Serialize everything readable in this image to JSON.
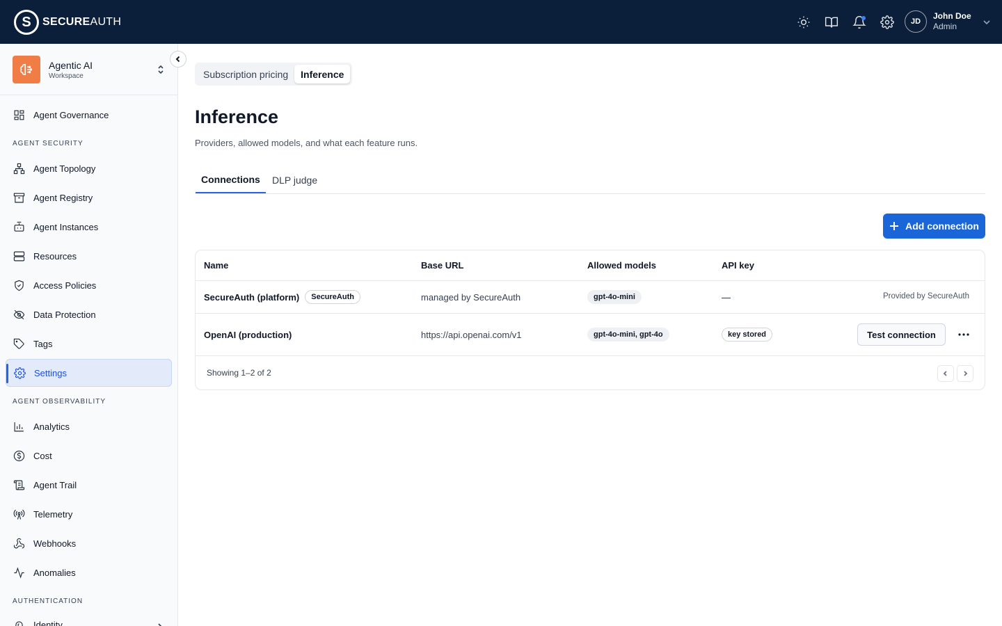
{
  "brand": {
    "logo_glyph": "S",
    "name_bold": "SECURE",
    "name_rest": "AUTH"
  },
  "topbar": {
    "icons": [
      "sun-icon",
      "book-icon",
      "bell-icon",
      "gear-icon"
    ],
    "user": {
      "initials": "JD",
      "name": "John Doe",
      "role": "Admin"
    }
  },
  "workspace": {
    "name": "Agentic AI",
    "subtitle": "Workspace",
    "icon": "agent-icon"
  },
  "sidebar": {
    "top_item": {
      "label": "Agent Governance",
      "icon": "grid-icon"
    },
    "sections": [
      {
        "title": "AGENT SECURITY"
      },
      {
        "title": "AGENT OBSERVABILITY"
      },
      {
        "title": "AUTHENTICATION"
      }
    ],
    "security_items": [
      {
        "label": "Agent Topology",
        "icon": "topology-icon"
      },
      {
        "label": "Agent Registry",
        "icon": "archive-icon"
      },
      {
        "label": "Agent Instances",
        "icon": "bot-icon"
      },
      {
        "label": "Resources",
        "icon": "server-icon"
      },
      {
        "label": "Access Policies",
        "icon": "shield-icon"
      },
      {
        "label": "Data Protection",
        "icon": "eye-off-icon"
      },
      {
        "label": "Tags",
        "icon": "tag-icon"
      },
      {
        "label": "Settings",
        "icon": "gear-icon",
        "active": true
      }
    ],
    "observability_items": [
      {
        "label": "Analytics",
        "icon": "bar-chart-icon"
      },
      {
        "label": "Cost",
        "icon": "dollar-icon"
      },
      {
        "label": "Agent Trail",
        "icon": "scroll-icon"
      },
      {
        "label": "Telemetry",
        "icon": "antenna-icon"
      },
      {
        "label": "Webhooks",
        "icon": "webhook-icon"
      },
      {
        "label": "Anomalies",
        "icon": "activity-icon"
      }
    ],
    "auth_items": [
      {
        "label": "Identity",
        "icon": "fingerprint-icon"
      }
    ]
  },
  "segmented": {
    "options": [
      "Subscription pricing",
      "Inference"
    ],
    "selected": "Inference"
  },
  "page": {
    "title": "Inference",
    "subtitle": "Providers, allowed models, and what each feature runs."
  },
  "tabs": {
    "items": [
      "Connections",
      "DLP judge"
    ],
    "selected": "Connections"
  },
  "add_button": {
    "label": "Add connection"
  },
  "table": {
    "columns": [
      "Name",
      "Base URL",
      "Allowed models",
      "API key"
    ],
    "rows": [
      {
        "name": "SecureAuth (platform)",
        "badge": "SecureAuth",
        "base_url": "managed by SecureAuth",
        "models": "gpt-4o-mini",
        "api_key": "—",
        "action_text": "Provided by SecureAuth"
      },
      {
        "name": "OpenAI (production)",
        "base_url": "https://api.openai.com/v1",
        "models": "gpt-4o-mini, gpt-4o",
        "api_key": "key stored",
        "action_button": "Test connection"
      }
    ],
    "footer": "Showing 1–2 of 2"
  },
  "colors": {
    "topbar": "#0b1f3a",
    "accent": "#1a66d9",
    "workspace_icon": "#f07c46"
  }
}
